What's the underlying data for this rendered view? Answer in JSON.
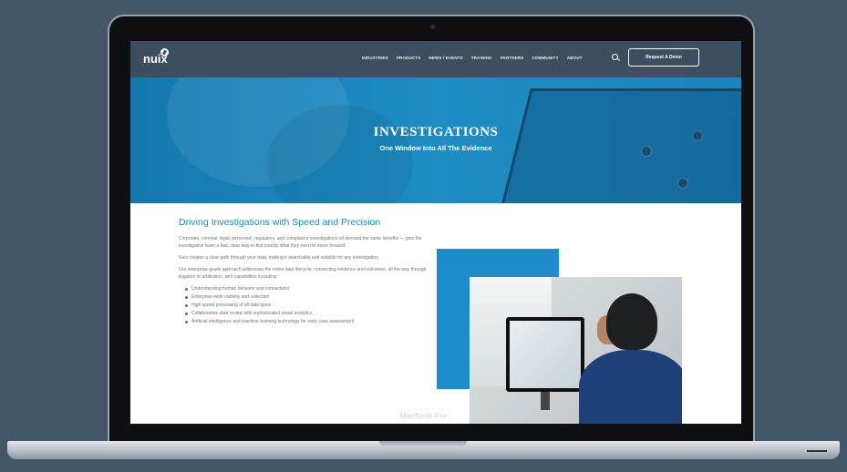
{
  "nav": {
    "logo_text": "nuix",
    "items": [
      "INDUSTRIES",
      "PRODUCTS",
      "NEWS / EVENTS",
      "TRAINING",
      "PARTNERS",
      "COMMUNITY",
      "ABOUT"
    ],
    "search_icon": "search-icon",
    "cta_label": "Request A Demo"
  },
  "hero": {
    "title": "INVESTIGATIONS",
    "subtitle": "One Window Into All The Evidence"
  },
  "content": {
    "heading": "Driving Investigations with Speed and Precision",
    "paragraphs": [
      "Corporate, criminal, legal, personnel, regulatory, and compliance investigations all demand the same benefits — give the investigative team a fast, clear way to find exactly what they need to move forward.",
      "Nuix creates a clear path through your data, making it searchable and suitable for any investigation.",
      "Our enterprise-grade approach addresses the entire data lifecycle, connecting evidence and outcomes, all the way through litigation or arbitration, with capabilities including:"
    ],
    "bullets": [
      "Understanding human behavior and connections",
      "Enterprise-wide visibility and collection",
      "High speed processing of all data types",
      "Collaborative data review with sophisticated visual analytics",
      "Artificial intelligence and machine learning technology for early case assessment"
    ]
  },
  "device": {
    "label": "MacBook Pro"
  },
  "colors": {
    "background": "#435569",
    "nav": "#3c4e5f",
    "hero": "#1e8dc4",
    "heading": "#1c8cc7",
    "body_text": "#6d7680"
  }
}
